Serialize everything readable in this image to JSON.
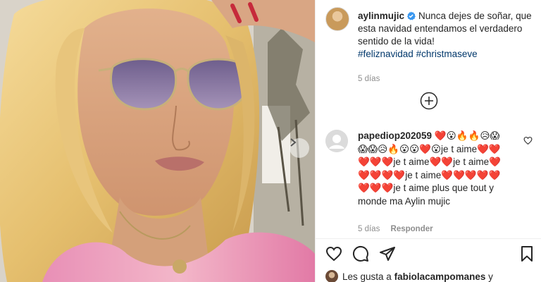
{
  "post": {
    "author": "aylinmujic",
    "caption_text": "Nunca dejes de soñar, que esta navidad entendamos el verdadero sentido de la vida!",
    "hashtags": [
      "#feliznavidad",
      "#christmaseve"
    ],
    "time": "5 días"
  },
  "comment": {
    "author": "papediop202059",
    "text": "❤️😮🔥🔥😥😱😱😱😥🔥😮😮❤️😮je t aime❤️❤️❤️❤️❤️je t aime❤️❤️je t aime❤️❤️❤️❤️❤️je t aime❤️❤️❤️❤️❤️❤️❤️❤️je t aime plus que tout y monde ma Aylin mujic",
    "time": "5 días",
    "reply_label": "Responder"
  },
  "likes": {
    "prefix": "Les gusta a",
    "user": "fabiolacampomanes",
    "suffix": "y"
  },
  "icons": {
    "verified": "verified-badge-icon",
    "load_more": "plus-circle-icon",
    "like": "heart-icon",
    "comment": "comment-icon",
    "share": "paper-plane-icon",
    "save": "bookmark-icon",
    "next": "chevron-right-icon"
  },
  "colors": {
    "verified": "#3897f0",
    "hashtag": "#00376b",
    "muted": "#8e8e8e",
    "text": "#262626"
  }
}
